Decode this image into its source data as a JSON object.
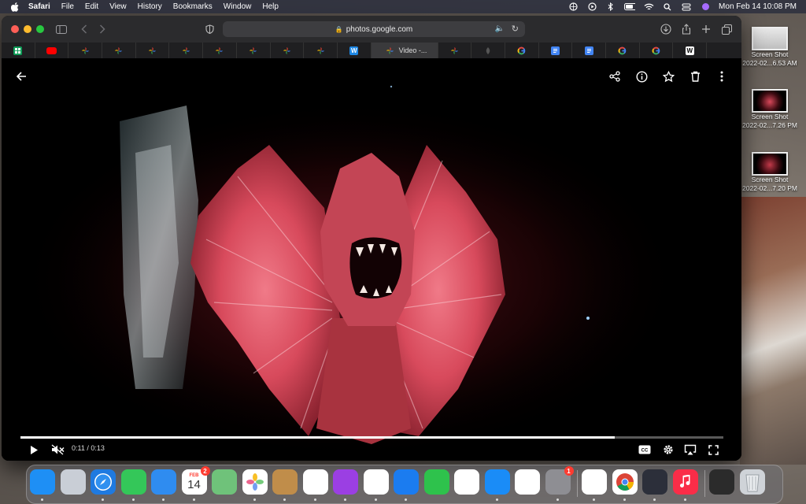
{
  "menubar": {
    "app_name": "Safari",
    "menus": [
      "File",
      "Edit",
      "View",
      "History",
      "Bookmarks",
      "Window",
      "Help"
    ],
    "clock": "Mon Feb 14  10:08 PM"
  },
  "desktop_icons": [
    {
      "line1": "Screen Shot",
      "line2": "2022-02...6.53 AM"
    },
    {
      "line1": "Screen Shot",
      "line2": "2022-02...7.26 PM"
    },
    {
      "line1": "Screen Shot",
      "line2": "2022-02...7.20 PM"
    }
  ],
  "browser": {
    "url": "photos.google.com",
    "active_tab_title": "Video -...",
    "tabs": [
      {
        "icon": "google-sheets-icon",
        "letter": "",
        "color": "#0f9d58"
      },
      {
        "icon": "youtube-icon",
        "letter": "",
        "color": "#ff0000"
      },
      {
        "icon": "google-photos-icon",
        "letter": "",
        "color": "#fbbc04"
      },
      {
        "icon": "google-photos-icon",
        "letter": "",
        "color": "#fbbc04"
      },
      {
        "icon": "google-photos-icon",
        "letter": "",
        "color": "#fbbc04"
      },
      {
        "icon": "google-photos-icon",
        "letter": "",
        "color": "#fbbc04"
      },
      {
        "icon": "google-photos-icon",
        "letter": "",
        "color": "#fbbc04"
      },
      {
        "icon": "google-photos-icon",
        "letter": "",
        "color": "#fbbc04"
      },
      {
        "icon": "google-photos-icon",
        "letter": "",
        "color": "#fbbc04"
      },
      {
        "icon": "google-photos-icon",
        "letter": "",
        "color": "#fbbc04"
      },
      {
        "icon": "site-icon",
        "letter": "W",
        "color": "#1e88e5"
      },
      {
        "icon": "google-photos-icon",
        "letter": "",
        "color": "#fbbc04",
        "active": true
      },
      {
        "icon": "google-photos-icon",
        "letter": "",
        "color": "#fbbc04"
      },
      {
        "icon": "leaf-icon",
        "letter": "",
        "color": "#666"
      },
      {
        "icon": "google-icon",
        "letter": "G",
        "color": "#ffffff"
      },
      {
        "icon": "google-docs-icon",
        "letter": "",
        "color": "#4285f4"
      },
      {
        "icon": "google-docs-icon",
        "letter": "",
        "color": "#4285f4"
      },
      {
        "icon": "google-icon",
        "letter": "G",
        "color": "#ffffff"
      },
      {
        "icon": "google-icon",
        "letter": "G",
        "color": "#ffffff"
      },
      {
        "icon": "site-icon",
        "letter": "W",
        "color": "#ffffff"
      }
    ]
  },
  "player": {
    "current_time": "0:11",
    "duration": "0:13",
    "time_display": "0:11 / 0:13",
    "progress_fraction": 0.846
  },
  "dock": {
    "apps": [
      {
        "name": "finder",
        "color": "#1e8ff5",
        "letter": ""
      },
      {
        "name": "launchpad",
        "color": "#c9ced6",
        "letter": ""
      },
      {
        "name": "safari",
        "color": "#1f7ae0",
        "letter": ""
      },
      {
        "name": "messages",
        "color": "#34c759",
        "letter": ""
      },
      {
        "name": "mail",
        "color": "#2f8cf0",
        "letter": ""
      },
      {
        "name": "calendar",
        "color": "#ffffff",
        "letter": "14",
        "month": "FEB",
        "badge": "2"
      },
      {
        "name": "maps",
        "color": "#6fc27a",
        "letter": ""
      },
      {
        "name": "photos",
        "color": "#ffffff",
        "letter": ""
      },
      {
        "name": "contacts",
        "color": "#c08d4a",
        "letter": ""
      },
      {
        "name": "reminders",
        "color": "#ffffff",
        "letter": ""
      },
      {
        "name": "podcasts",
        "color": "#9b3fe3",
        "letter": ""
      },
      {
        "name": "notes",
        "color": "#ffffff",
        "letter": ""
      },
      {
        "name": "keynote",
        "color": "#1b7cf0",
        "letter": ""
      },
      {
        "name": "facetime",
        "color": "#2ec24c",
        "letter": ""
      },
      {
        "name": "numbers",
        "color": "#ffffff",
        "letter": ""
      },
      {
        "name": "app-store",
        "color": "#1a8cf7",
        "letter": ""
      },
      {
        "name": "pages",
        "color": "#ffffff",
        "letter": ""
      },
      {
        "name": "system-preferences",
        "color": "#8e8e93",
        "letter": "",
        "badge": "1"
      },
      {
        "name": "messenger",
        "color": "#ffffff",
        "letter": ""
      },
      {
        "name": "chrome",
        "color": "#ffffff",
        "letter": ""
      },
      {
        "name": "davinci-resolve",
        "color": "#2c2f3a",
        "letter": ""
      },
      {
        "name": "music",
        "color": "#fa2d48",
        "letter": ""
      },
      {
        "name": "screenshot-stack",
        "color": "#2b2b2b",
        "letter": ""
      },
      {
        "name": "trash",
        "color": "#cfd3d8",
        "letter": ""
      }
    ]
  }
}
